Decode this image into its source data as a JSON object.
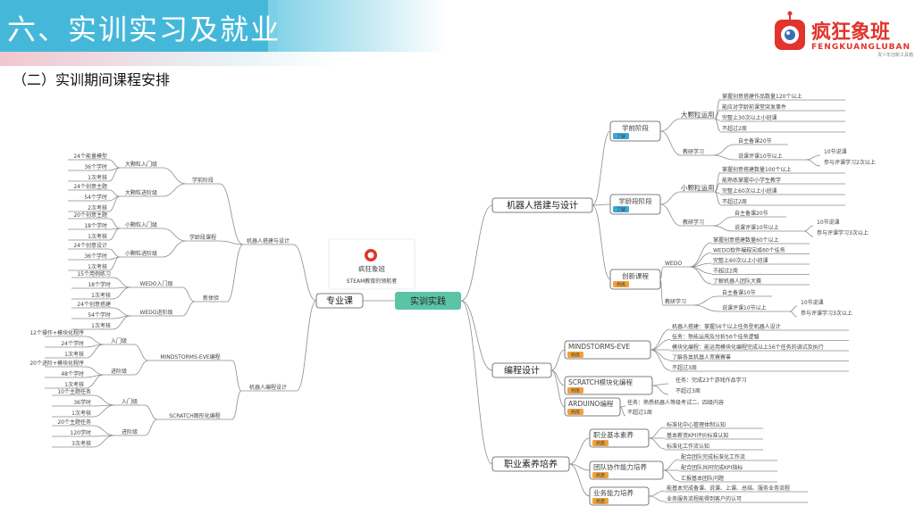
{
  "header": {
    "title": "六、实训实习及就业",
    "subtitle": "（二）实训期间课程安排",
    "logo_text": "疯狂象班",
    "logo_sub": "FENGKUANGLUBAN",
    "logo_sub2": "青少年创新工具箱"
  },
  "center": {
    "root": "实训实践",
    "left_hub": "专业课",
    "card_name": "疯狂象班",
    "card_caption": "STEAM教育的领航者"
  },
  "left": {
    "group1": "机器人搭建与设计",
    "g1_sub1": "学前阶段",
    "g1_sub1_items": [
      {
        "label": "大颗粒入门级",
        "details": [
          "24个能量模型",
          "36个学时",
          "1次考核"
        ]
      },
      {
        "label": "大颗粒进阶级",
        "details": [
          "24个创意主题",
          "54个学时",
          "2次考核"
        ]
      }
    ],
    "g1_sub2": "学龄段课程",
    "g1_sub2_items": [
      {
        "label": "小颗粒入门级",
        "details": [
          "20个创意主题",
          "18个学时",
          "1次考核"
        ]
      },
      {
        "label": "小颗粒进阶级",
        "details": [
          "24个创意设计",
          "36个学时",
          "1次考核"
        ]
      }
    ],
    "g1_sub3": "新体验",
    "g1_sub3_items": [
      {
        "label": "WEDO入门级",
        "details": [
          "15个用例练习",
          "18个学时",
          "1次考核"
        ]
      },
      {
        "label": "WEDO进阶级",
        "details": [
          "24个创意搭建",
          "54个学时",
          "1次考核"
        ]
      }
    ],
    "group2": "机器人编程设计",
    "g2_sub1": "MINDSTORMS-EVE编程",
    "g2_sub1_items": [
      {
        "label": "入门级",
        "details": [
          "12个操作+模块化程序",
          "24个学时",
          "1次考核"
        ]
      },
      {
        "label": "进阶级",
        "details": [
          "20个进阶+模块化程序",
          "48个学时",
          "1次考核"
        ]
      }
    ],
    "g2_sub2": "SCRATCH图形化编程",
    "g2_sub2_items": [
      {
        "label": "入门级",
        "details": [
          "10个主题任务",
          "36学时",
          "1次考核"
        ]
      },
      {
        "label": "进阶级",
        "details": [
          "20个主题任务",
          "120学时",
          "3次考核"
        ]
      }
    ]
  },
  "right": {
    "group1": "机器人搭建与设计",
    "g1_stage1": "学前阶段",
    "g1_stage1_badge": "了解",
    "g1_stage1_a": "大颗粒运用",
    "g1_stage1_a_items": [
      "掌握创意搭建作品数量120个以上",
      "能应对学龄前课堂突发事件",
      "完整上30次以上小班课",
      "不超过2周"
    ],
    "g1_stage1_b": "教研学习",
    "g1_stage1_b_items": [
      "自主备课20节",
      "说课评课10节以上"
    ],
    "g1_stage1_b_sub": [
      "10节说课",
      "参与评课学习2次以上"
    ],
    "g1_stage2": "学龄段阶段",
    "g1_stage2_badge": "了解",
    "g1_stage2_a": "小颗粒运用",
    "g1_stage2_a_items": [
      "掌握创意搭建数量100个以上",
      "能熟练掌握中小学生教学",
      "完整上60次以上小班课",
      "不超过2周"
    ],
    "g1_stage2_b": "教研学习",
    "g1_stage2_b_items": [
      "自主备课20节",
      "说课评课10节以上"
    ],
    "g1_stage2_b_sub": [
      "10节说课",
      "参与评课学习3次以上"
    ],
    "g1_stage3": "创新课程",
    "g1_stage3_badge": "熟练",
    "g1_stage3_a": "WEDO",
    "g1_stage3_a_items": [
      "掌握创意搭建数量60个以上",
      "WEDO软件编程完成60个任务",
      "完整上60次以上小班课",
      "不超过2周",
      "了解机器人团队大赛"
    ],
    "g1_stage3_b": "教研学习",
    "g1_stage3_b_items": [
      "自主备课10节",
      "说课评课10节以上"
    ],
    "g1_stage3_b_sub": [
      "10节说课",
      "参与评课学习3次以上"
    ],
    "group2": "编程设计",
    "g2_items": [
      {
        "label": "MINDSTORMS-EVE",
        "badge": "熟练",
        "details": [
          "机器人搭建：掌握56个以上任务型机器人设计",
          "任务：熟练运用及分析56个任务逻辑",
          "模块化编程：能运用模块化编程完成以上56个任务的调试及执行",
          "了解各类机器人竞赛赛事",
          "不超过3周"
        ]
      },
      {
        "label": "SCRATCH模块化编程",
        "badge": "熟练",
        "details": [
          "任务：完成23个游戏作品学习",
          "不超过3周"
        ]
      },
      {
        "label": "ARDUINO编程",
        "badge": "熟练",
        "details": [
          "任务：熟悉机器人等级考试二、四级内容",
          "不超过1周"
        ]
      }
    ],
    "group3": "职业素养培养",
    "g3_items": [
      {
        "label": "职业基本素养",
        "badge": "熟悉",
        "details": [
          "标准化中心管理体制认知",
          "基本薪资KPI评价标准认知",
          "标准化工作流认知"
        ]
      },
      {
        "label": "团队协作能力培养",
        "badge": "熟悉",
        "details": [
          "配合团队完成标准化工作流",
          "配合团队共同完成KPI指标",
          "汇报基本团队问题"
        ]
      },
      {
        "label": "业务能力培养",
        "badge": "熟悉",
        "details": [
          "能基本完成备课、说课、上课、总结、服务业务流程",
          "业务服务流程能得到客户的认可"
        ]
      }
    ]
  },
  "colors": {
    "banner": "#45b8d9",
    "root": "#5bc4a6",
    "line": "#8c8c8c",
    "badge_blue": "#3aa7d8",
    "badge_orange": "#f0a23a",
    "red_text": "#e0342c",
    "logo_red": "#e0342c"
  }
}
